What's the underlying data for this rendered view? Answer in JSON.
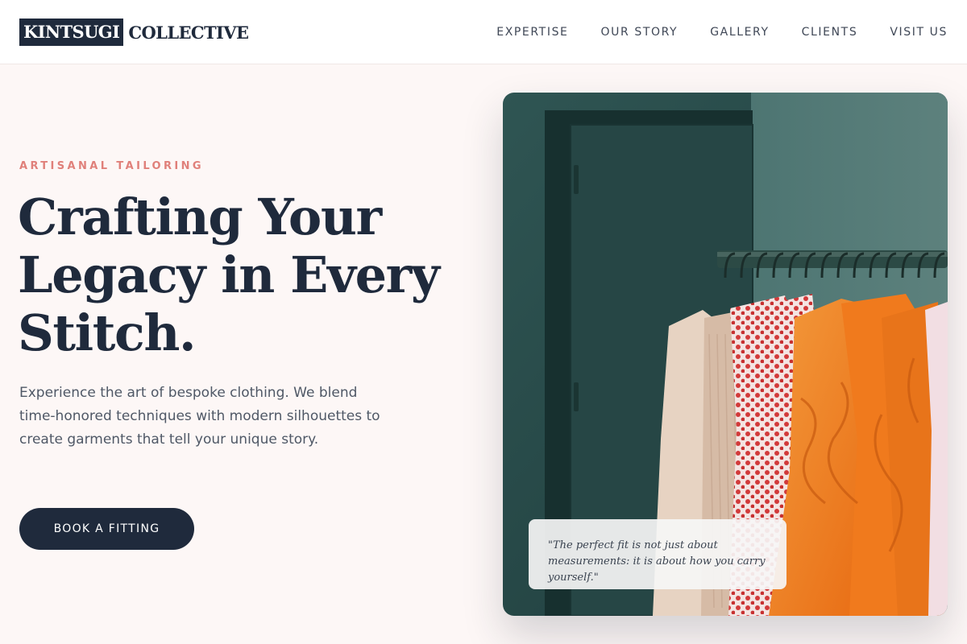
{
  "brand": {
    "logo_box_text": "KINTSUGI",
    "logo_text": "COLLECTIVE"
  },
  "nav": {
    "items": [
      {
        "label": "EXPERTISE"
      },
      {
        "label": "OUR STORY"
      },
      {
        "label": "GALLERY"
      },
      {
        "label": "CLIENTS"
      },
      {
        "label": "VISIT US"
      }
    ]
  },
  "hero": {
    "eyebrow": "ARTISANAL TAILORING",
    "headline": "Crafting Your Legacy in Every Stitch.",
    "intro": "Experience the art of bespoke clothing. We blend time-honored techniques with modern silhouettes to create garments that tell your unique story.",
    "cta_label": "BOOK A FITTING",
    "quote": "\"The perfect fit is not just about measurements: it is about how you carry yourself.\""
  },
  "colors": {
    "navy": "#1f2a3c",
    "accent": "#e0807a",
    "page_bg": "#fdf7f6"
  },
  "image": {
    "subject": "clothing rack with hanging garments"
  }
}
